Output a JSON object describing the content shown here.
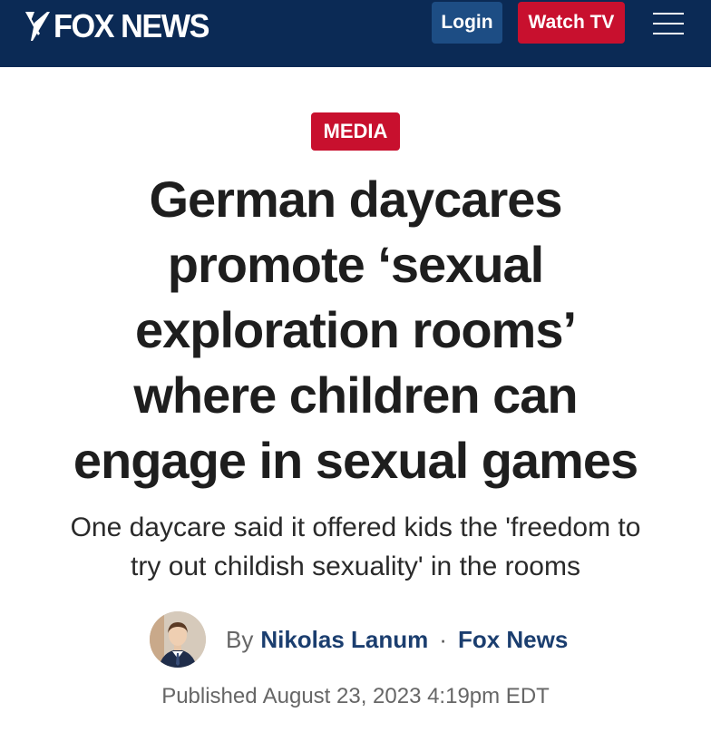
{
  "header": {
    "brand": "FOX NEWS",
    "login_label": "Login",
    "watch_tv_label": "Watch TV",
    "menu_icon": "hamburger-menu-icon",
    "colors": {
      "background": "#0b2a55",
      "login_button": "#1d4d84",
      "watch_tv_button": "#c8102e"
    }
  },
  "article": {
    "category": "MEDIA",
    "headline_lines": [
      "German daycares",
      "promote ‘sexual",
      "exploration rooms’",
      "where children can",
      "engage in sexual games"
    ],
    "subheadline_lines": [
      "One daycare said it offered kids the 'freedom to",
      "try out childish sexuality' in the rooms"
    ],
    "byline": {
      "by_label": "By",
      "author": "Nikolas Lanum",
      "separator": "·",
      "outlet": "Fox News",
      "avatar_icon": "author-avatar"
    },
    "published_label": "Published",
    "published_date": "August 23, 2023 4:19pm EDT"
  }
}
